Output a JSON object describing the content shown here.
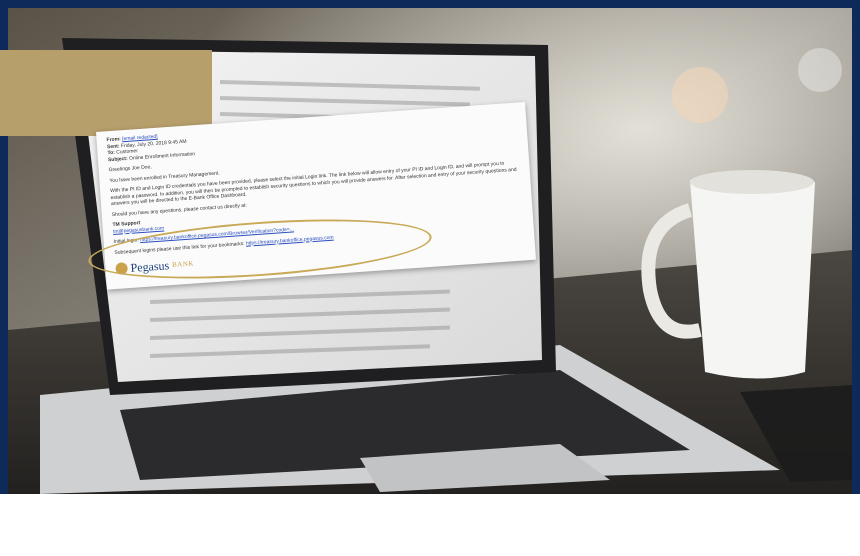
{
  "email": {
    "from_label": "From:",
    "from_value": "[email redacted]",
    "sent_label": "Sent:",
    "sent_value": "Friday, July 20, 2018 9:45 AM",
    "to_label": "To:",
    "to_value": "Customer",
    "subject_label": "Subject:",
    "subject_value": "Online Enrollment Information",
    "greeting": "Greetings Joe Doe,",
    "line1": "You have been enrolled in Treasury Management.",
    "line2": "With the PI ID and Login ID credentials you have been provided, please select the initial Login link. The link below will allow entry of your PI ID and Login ID, and will prompt you to establish a password. In addition, you will then be prompted to establish security questions to which you will provide answers for. After selection and entry of your security questions and answers you will be directed to the E-Bank Office Dashboard.",
    "line3": "Should you have any questions, please contact us directly at:",
    "support_name": "TM Support",
    "support_contact": "tm@pegasusbank.com",
    "initial_login_label": "Initial login:",
    "initial_login_link": "https://treasury.bankoffice.pegasus.com/Browser/Verification?code=...",
    "bookmark_label": "Subsequent logins please use this link for your bookmarks:",
    "bookmark_link": "https://treasury.bankoffice.pegasus.com",
    "logo_text": "Pegasus",
    "logo_suffix": "BANK"
  },
  "colors": {
    "frame_navy": "#0d2a5a",
    "gold_accent": "#b79f6c",
    "highlight_ring": "#c7a957",
    "link_blue": "#2a4fbf"
  }
}
